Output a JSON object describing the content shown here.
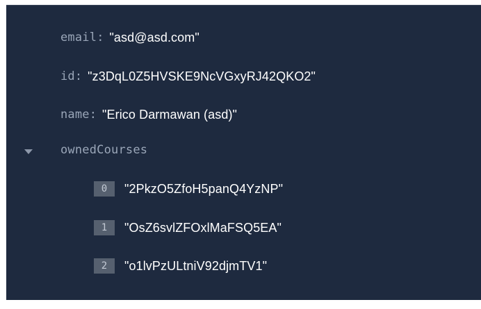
{
  "document": {
    "email": {
      "key": "email",
      "value": "\"asd@asd.com\""
    },
    "id": {
      "key": "id",
      "value": "\"z3DqL0Z5HVSKE9NcVGxyRJ42QKO2\""
    },
    "name": {
      "key": "name",
      "value": "\"Erico Darmawan (asd)\""
    },
    "ownedCourses": {
      "key": "ownedCourses",
      "expanded": true,
      "items": [
        {
          "index": "0",
          "value": "\"2PkzO5ZfoH5panQ4YzNP\""
        },
        {
          "index": "1",
          "value": "\"OsZ6svlZFOxlMaFSQ5EA\""
        },
        {
          "index": "2",
          "value": "\"o1lvPzULtniV92djmTV1\""
        }
      ]
    }
  },
  "colors": {
    "background": "#1e2a3f",
    "key": "#9aa6b8",
    "value": "#ffffff",
    "index_badge": "#56606f"
  }
}
